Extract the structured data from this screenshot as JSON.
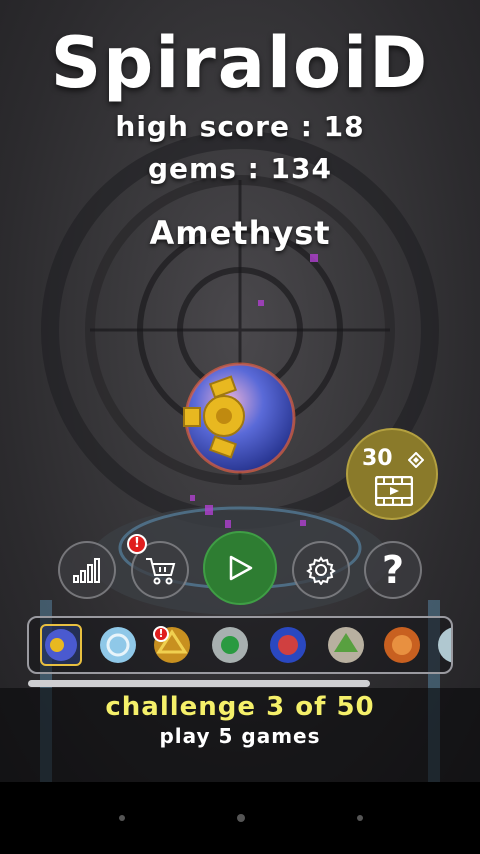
{
  "game": {
    "title": "SpiraloiD",
    "high_score_text": "high score : 18",
    "gems_text": "gems : 134",
    "ball_name": "Amethyst"
  },
  "buttons": {
    "stats_icon": "bar-chart-icon",
    "shop_icon": "cart-icon",
    "shop_badge": "!",
    "play_icon": "play-icon",
    "settings_icon": "gear-icon",
    "help_label": "?"
  },
  "video_reward": {
    "amount": "30",
    "gem_icon": "gem-icon",
    "film_icon": "film-play-icon"
  },
  "ball_strip": {
    "items": [
      {
        "name": "ball-1",
        "selected": true,
        "badge": false
      },
      {
        "name": "ball-2",
        "selected": false,
        "badge": false
      },
      {
        "name": "ball-3",
        "selected": false,
        "badge": true,
        "badge_text": "!"
      },
      {
        "name": "ball-4",
        "selected": false,
        "badge": false
      },
      {
        "name": "ball-5",
        "selected": false,
        "badge": false
      },
      {
        "name": "ball-6",
        "selected": false,
        "badge": false
      },
      {
        "name": "ball-7",
        "selected": false,
        "badge": false
      },
      {
        "name": "ball-8",
        "selected": false,
        "badge": false
      }
    ]
  },
  "challenge": {
    "title": "challenge 3 of 50",
    "description": "play 5 games"
  },
  "colors": {
    "play_green": "#2e7d32",
    "video_gold": "#8a7a2a",
    "challenge_yellow": "#f5f06a",
    "badge_red": "#e01e1e"
  }
}
